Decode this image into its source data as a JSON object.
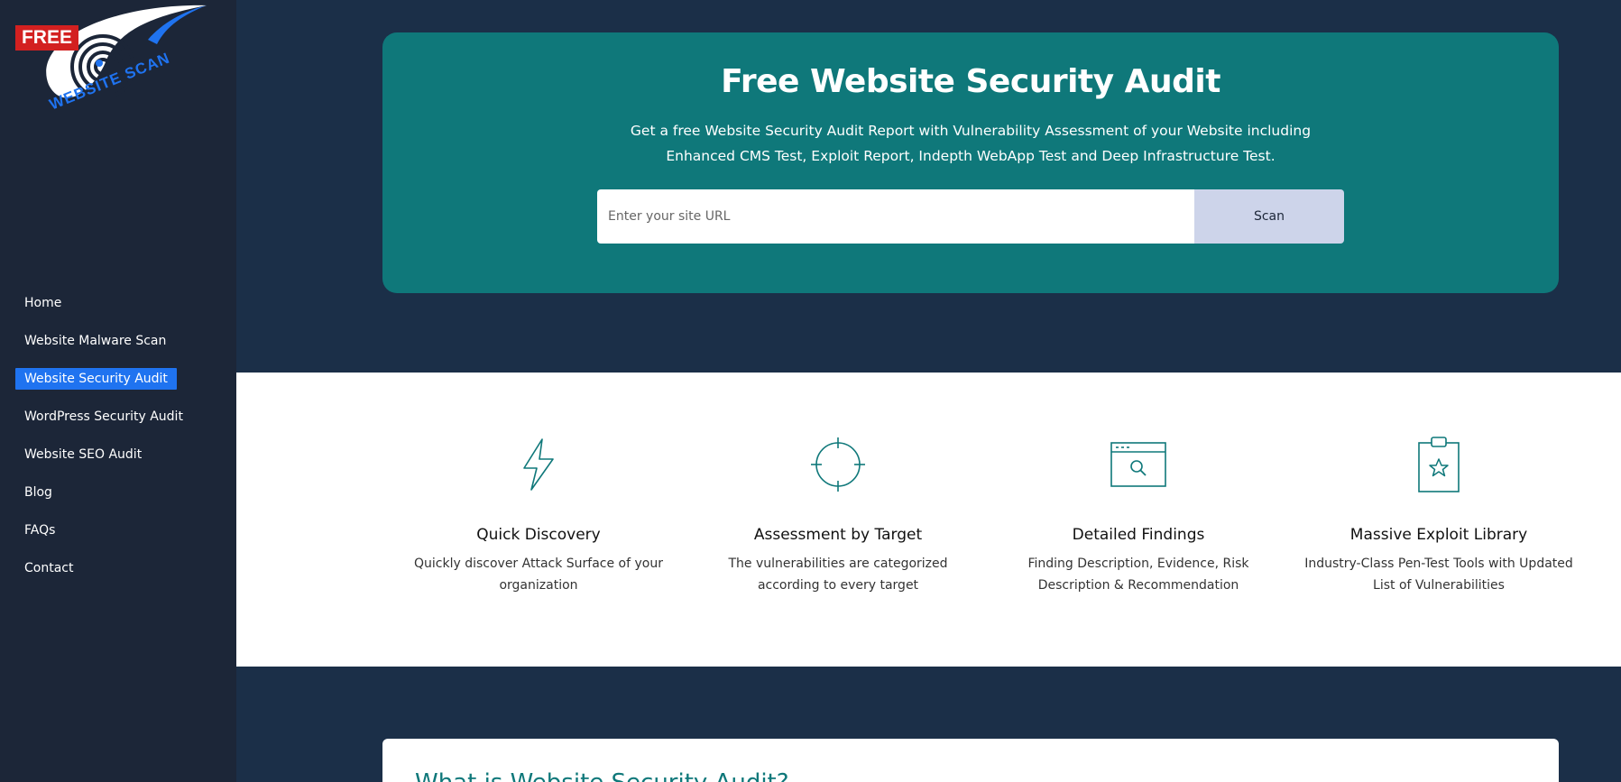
{
  "brand": {
    "logo_badge": "FREE",
    "logo_text": "WEBSITE SCAN"
  },
  "sidebar": {
    "items": [
      {
        "label": "Home",
        "active": false
      },
      {
        "label": "Website Malware Scan",
        "active": false
      },
      {
        "label": "Website Security Audit",
        "active": true
      },
      {
        "label": "WordPress Security Audit",
        "active": false
      },
      {
        "label": "Website SEO Audit",
        "active": false
      },
      {
        "label": "Blog",
        "active": false
      },
      {
        "label": "FAQs",
        "active": false
      },
      {
        "label": "Contact",
        "active": false
      }
    ]
  },
  "hero": {
    "title": "Free Website Security Audit",
    "description": "Get a free Website Security Audit Report with Vulnerability Assessment of your Website including Enhanced CMS Test, Exploit Report, Indepth WebApp Test and Deep Infrastructure Test.",
    "input_placeholder": "Enter your site URL",
    "button_label": "Scan"
  },
  "features": [
    {
      "icon": "lightning-icon",
      "title": "Quick Discovery",
      "text": "Quickly discover Attack Surface of your organization"
    },
    {
      "icon": "crosshair-icon",
      "title": "Assessment by Target",
      "text": "The vulnerabilities are categorized according to every target"
    },
    {
      "icon": "browser-search-icon",
      "title": "Detailed Findings",
      "text": "Finding Description, Evidence, Risk Description & Recommendation"
    },
    {
      "icon": "clipboard-star-icon",
      "title": "Massive Exploit Library",
      "text": "Industry-Class Pen-Test Tools with Updated List of Vulnerabilities"
    }
  ],
  "article": {
    "heading": "What is Website Security Audit?"
  },
  "colors": {
    "sidebar_bg": "#1c2638",
    "page_bg": "#1b2f48",
    "hero_bg": "#0f787a",
    "active_nav": "#1f73f0",
    "scan_button": "#cdd4ea"
  }
}
